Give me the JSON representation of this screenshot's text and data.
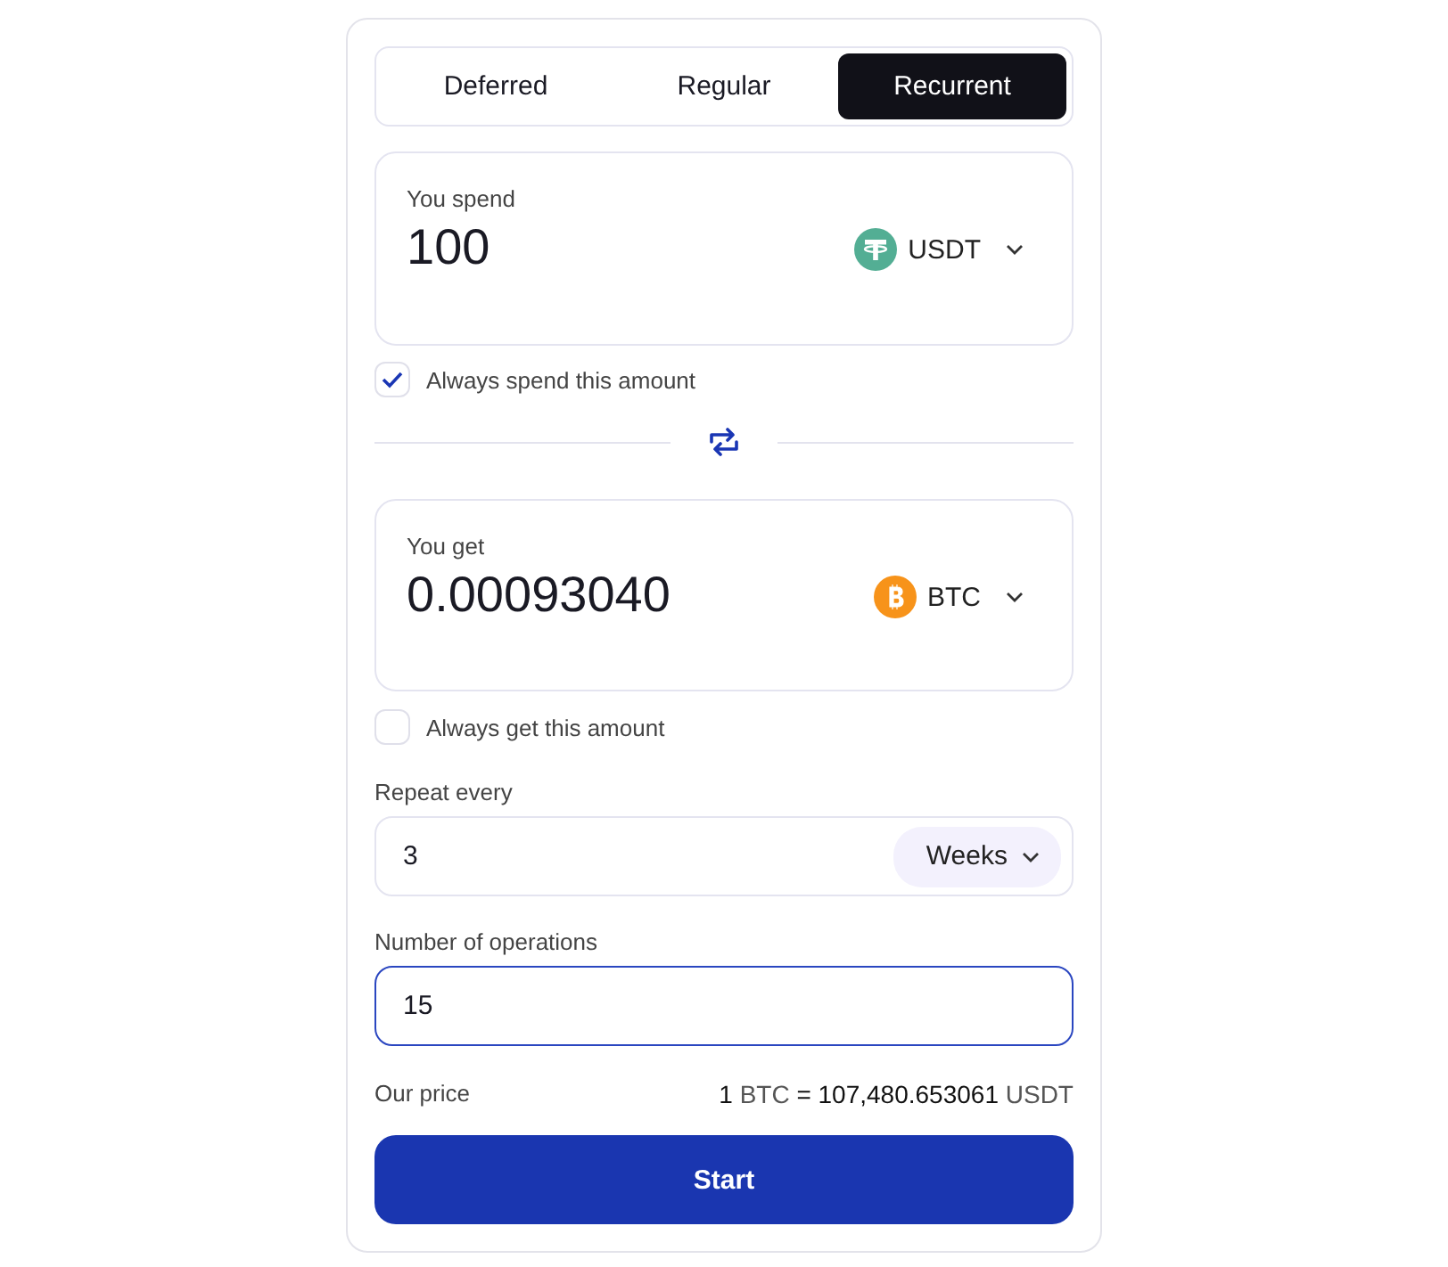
{
  "tabs": [
    {
      "label": "Deferred",
      "selected": false
    },
    {
      "label": "Regular",
      "selected": false
    },
    {
      "label": "Recurrent",
      "selected": true
    }
  ],
  "spend": {
    "label": "You spend",
    "value": "100",
    "currency": {
      "code": "USDT",
      "kind": "tether"
    },
    "option": {
      "label": "Always spend this amount",
      "checked": true
    }
  },
  "get": {
    "label": "You get",
    "value": "0.00093040",
    "currency": {
      "code": "BTC",
      "kind": "bitcoin"
    },
    "option": {
      "label": "Always get this amount",
      "checked": false
    }
  },
  "repeat": {
    "label": "Repeat every",
    "value": "3",
    "unit": "Weeks",
    "focused": false
  },
  "operations": {
    "label": "Number of operations",
    "value": "15",
    "focused": true
  },
  "price": {
    "label": "Our price",
    "amount_from": "1",
    "currency_from": "BTC",
    "equals": "=",
    "amount_to": "107,480.653061",
    "currency_to": "USDT"
  },
  "submit": {
    "label": "Start"
  }
}
